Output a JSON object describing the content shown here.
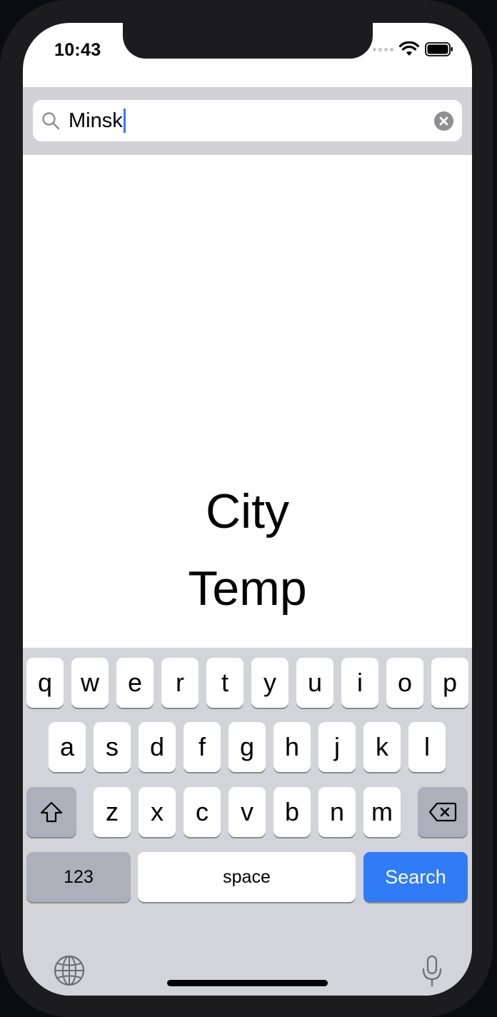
{
  "status_bar": {
    "time": "10:43"
  },
  "search": {
    "value": "Minsk"
  },
  "main": {
    "city_label": "City",
    "temp_label": "Temp"
  },
  "keyboard": {
    "row1": [
      "q",
      "w",
      "e",
      "r",
      "t",
      "y",
      "u",
      "i",
      "o",
      "p"
    ],
    "row2": [
      "a",
      "s",
      "d",
      "f",
      "g",
      "h",
      "j",
      "k",
      "l"
    ],
    "row3": [
      "z",
      "x",
      "c",
      "v",
      "b",
      "n",
      "m"
    ],
    "numbers_label": "123",
    "space_label": "space",
    "return_label": "Search"
  },
  "colors": {
    "accent": "#2f7cf6",
    "keyboard_bg": "#d2d4da",
    "search_bar_bg": "#d1d1d6"
  },
  "icons": {
    "search": "search-icon",
    "clear": "clear-icon",
    "shift": "shift-icon",
    "delete": "delete-icon",
    "globe": "globe-icon",
    "mic": "microphone-icon",
    "wifi": "wifi-icon",
    "battery": "battery-icon"
  }
}
